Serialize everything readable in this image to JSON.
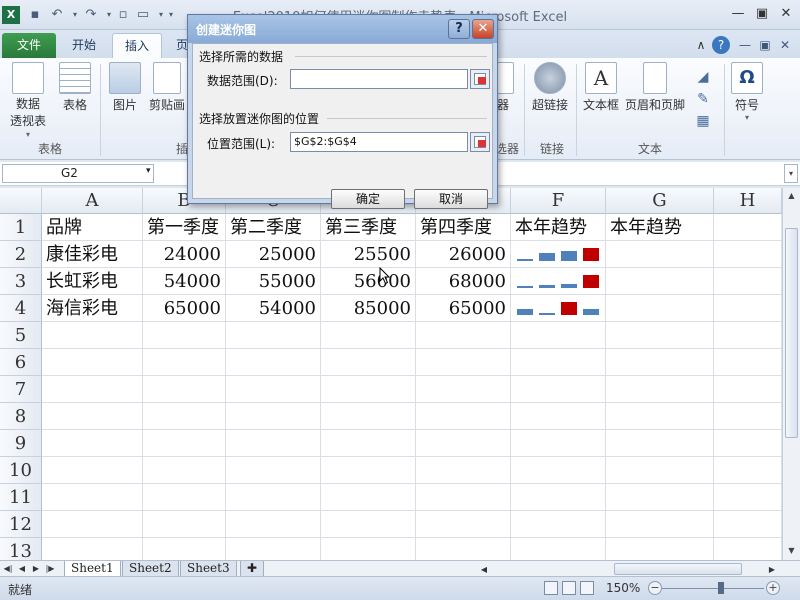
{
  "window": {
    "title": "Excel2010如何使用迷你图制作走势表 - Microsoft Excel",
    "qat_icons": [
      "excel-icon",
      "save-icon",
      "undo-icon",
      "undo-dropdown-icon",
      "redo-icon",
      "redo-dropdown-icon",
      "new-icon",
      "open-icon",
      "open-dropdown-icon",
      "customize-qat-icon"
    ],
    "controls": [
      "minimize-icon",
      "restore-icon",
      "close-icon"
    ]
  },
  "ribbon": {
    "tabs": [
      "文件",
      "开始",
      "插入",
      "页"
    ],
    "active_tab": "插入",
    "left_buttons": [
      {
        "label": "数据\n透视表",
        "caret": "▾"
      },
      {
        "label": "表格"
      },
      {
        "label": "图片"
      },
      {
        "label": "剪贴画"
      }
    ],
    "right_buttons": [
      {
        "label": "器"
      },
      {
        "label": "超链接"
      },
      {
        "label": "文本框"
      },
      {
        "label": "页眉和页脚"
      },
      {
        "label": "符号",
        "glyph": "Ω"
      }
    ],
    "groups": [
      "表格",
      "插",
      "选器",
      "链接",
      "文本"
    ]
  },
  "formula_bar": {
    "name_box": "G2",
    "formula": ""
  },
  "sheet": {
    "columns": [
      "A",
      "B",
      "C",
      "D",
      "E",
      "F",
      "G",
      "H"
    ],
    "rows": [
      "1",
      "2",
      "3",
      "4",
      "5",
      "6",
      "7",
      "8",
      "9",
      "10",
      "11",
      "12",
      "13"
    ],
    "header_row": [
      "品牌",
      "第一季度",
      "第二季度",
      "第三季度",
      "第四季度",
      "本年趋势",
      "本年趋势"
    ],
    "data_rows": [
      {
        "brand": "康佳彩电",
        "q": [
          "24000",
          "25000",
          "25500",
          "26000"
        ]
      },
      {
        "brand": "长虹彩电",
        "q": [
          "54000",
          "55000",
          "56000",
          "68000"
        ]
      },
      {
        "brand": "海信彩电",
        "q": [
          "65000",
          "54000",
          "85000",
          "65000"
        ]
      }
    ],
    "sparkline_colors": {
      "bar": "#4f81bd",
      "high": "#c00000"
    },
    "sparklines": [
      {
        "values": [
          24000,
          25000,
          25500,
          26000
        ]
      },
      {
        "values": [
          54000,
          55000,
          56000,
          68000
        ]
      },
      {
        "values": [
          65000,
          54000,
          85000,
          65000
        ]
      }
    ]
  },
  "sheet_tabs": [
    "Sheet1",
    "Sheet2",
    "Sheet3"
  ],
  "active_sheet": "Sheet1",
  "status": {
    "ready": "就绪",
    "zoom": "150%",
    "zoom_level": 150
  },
  "dialog": {
    "title": "创建迷你图",
    "help": "?",
    "close": "✕",
    "section1": "选择所需的数据",
    "data_range_label": "数据范围(D):",
    "data_range_value": "",
    "section2": "选择放置迷你图的位置",
    "location_range_label": "位置范围(L):",
    "location_range_value": "$G$2:$G$4",
    "ok": "确定",
    "cancel": "取消"
  }
}
